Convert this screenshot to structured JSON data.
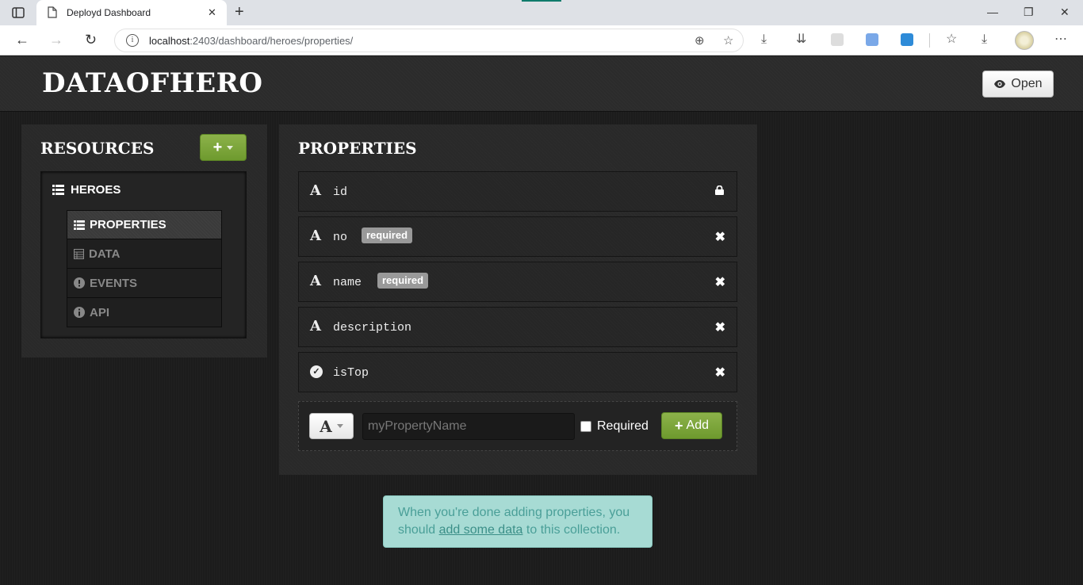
{
  "browser": {
    "tab_title": "Deployd Dashboard",
    "url_host": "localhost",
    "url_rest": ":2403/dashboard/heroes/properties/"
  },
  "app": {
    "title": "DATAOFHERO",
    "open_label": "Open"
  },
  "resources": {
    "heading": "RESOURCES",
    "items": [
      {
        "label": "HEROES",
        "subnav": [
          {
            "label": "PROPERTIES",
            "icon": "list-icon",
            "active": true
          },
          {
            "label": "DATA",
            "icon": "table-icon",
            "active": false
          },
          {
            "label": "EVENTS",
            "icon": "exclamation-circle-icon",
            "active": false
          },
          {
            "label": "API",
            "icon": "info-circle-icon",
            "active": false
          }
        ]
      }
    ]
  },
  "properties": {
    "heading": "PROPERTIES",
    "rows": [
      {
        "type_glyph": "A",
        "name": "id",
        "required": false,
        "action": "lock"
      },
      {
        "type_glyph": "A",
        "name": "no",
        "required": true,
        "required_label": "required",
        "action": "remove"
      },
      {
        "type_glyph": "A",
        "name": "name",
        "required": true,
        "required_label": "required",
        "action": "remove"
      },
      {
        "type_glyph": "A",
        "name": "description",
        "required": false,
        "action": "remove"
      },
      {
        "type_glyph": "check",
        "name": "isTop",
        "required": false,
        "action": "remove"
      }
    ],
    "add_form": {
      "type_glyph": "A",
      "name_placeholder": "myPropertyName",
      "required_label": "Required",
      "add_label": "Add"
    }
  },
  "hint": {
    "before": "When you're done adding properties, you should ",
    "link": "add some data",
    "after": " to this collection."
  },
  "colors": {
    "accent_green": "#7aa63a",
    "hint_bg": "#a7dbd4",
    "badge_gray": "#999999"
  }
}
